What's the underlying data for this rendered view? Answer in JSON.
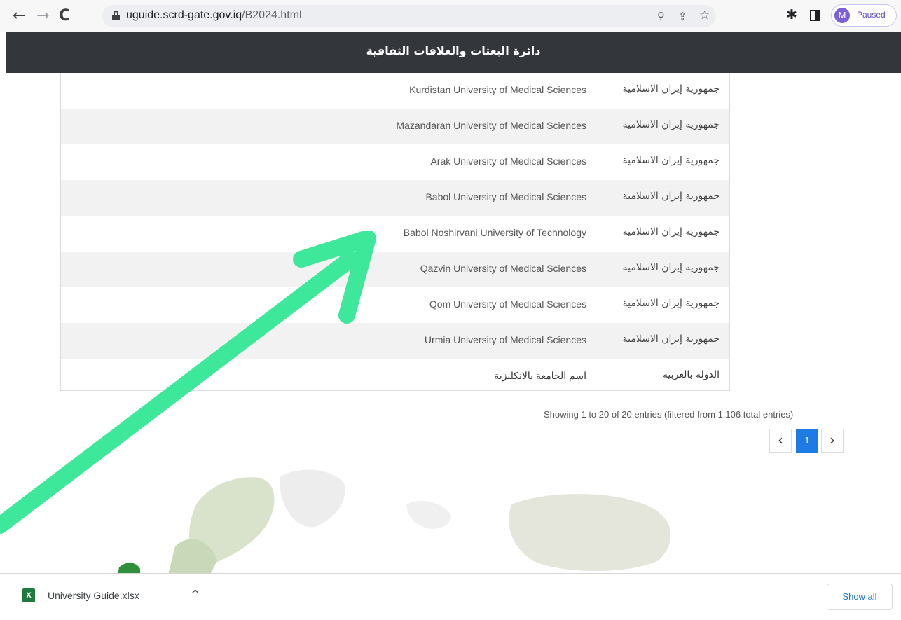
{
  "browser": {
    "url_host": "uguide.scrd-gate.gov.iq",
    "url_path": "/B2024.html",
    "profile_initial": "M",
    "profile_status": "Paused"
  },
  "header": {
    "title": "دائرة البعثات والعلاقات الثقافية"
  },
  "table": {
    "rows": [
      {
        "university_en": "Kurdistan University of Medical Sciences",
        "country_ar": "جمهورية إيران الاسلامية"
      },
      {
        "university_en": "Mazandaran University of Medical Sciences",
        "country_ar": "جمهورية إيران الاسلامية"
      },
      {
        "university_en": "Arak University of Medical Sciences",
        "country_ar": "جمهورية إيران الاسلامية"
      },
      {
        "university_en": "Babol University of Medical Sciences",
        "country_ar": "جمهورية إيران الاسلامية"
      },
      {
        "university_en": "Babol Noshirvani University of Technology",
        "country_ar": "جمهورية إيران الاسلامية"
      },
      {
        "university_en": "Qazvin University of Medical Sciences",
        "country_ar": "جمهورية إيران الاسلامية"
      },
      {
        "university_en": "Qom University of Medical Sciences",
        "country_ar": "جمهورية إيران الاسلامية"
      },
      {
        "university_en": "Urmia University of Medical Sciences",
        "country_ar": "جمهورية إيران الاسلامية"
      }
    ],
    "footer": {
      "university_en": "اسم الجامعة بالانكليزية",
      "country_ar": "الدولة بالعربية"
    }
  },
  "info_text": "Showing 1 to 20 of 20 entries (filtered from 1,106 total entries)",
  "pagination": {
    "prev": "‹",
    "current": "1",
    "next": "›"
  },
  "download": {
    "file_name": "University Guide.xlsx",
    "show_all": "Show all"
  },
  "icons": {
    "back": "back-arrow-icon",
    "forward": "forward-arrow-icon",
    "reload": "reload-icon",
    "lock": "lock-icon",
    "zoom": "zoom-icon",
    "share": "share-icon",
    "star": "bookmark-star-icon",
    "extensions": "puzzle-icon",
    "sidepanel": "side-panel-icon",
    "file": "excel-file-icon",
    "arrow": "green-annotation-arrow"
  },
  "colors": {
    "header_bg": "#33363a",
    "page_active": "#1e7be6",
    "annotation_arrow": "#3ee89a"
  }
}
